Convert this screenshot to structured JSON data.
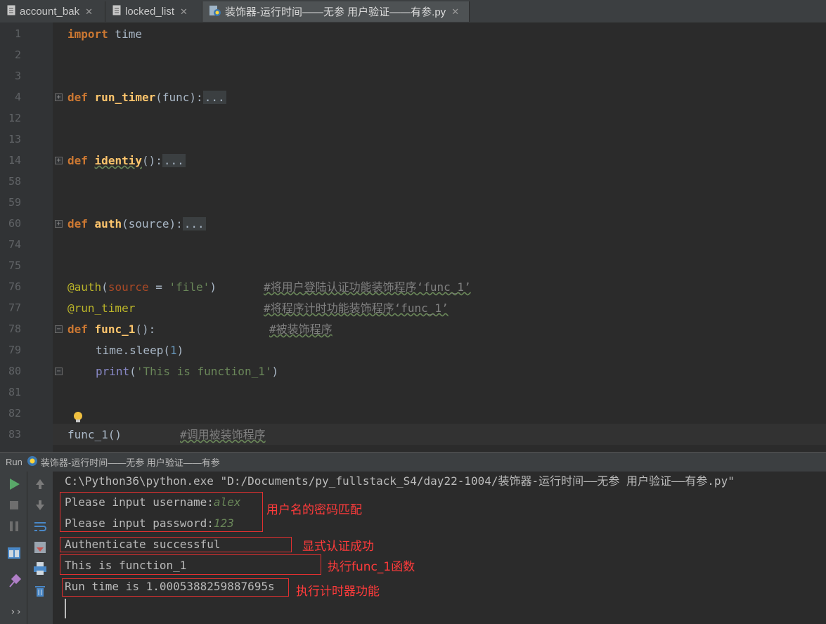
{
  "tabs": [
    {
      "label": "account_bak"
    },
    {
      "label": "locked_list"
    },
    {
      "label": "装饰器-运行时间——无参 用户验证——有参.py"
    }
  ],
  "editor": {
    "line_numbers": [
      "1",
      "2",
      "3",
      "4",
      "12",
      "13",
      "14",
      "58",
      "59",
      "60",
      "74",
      "75",
      "76",
      "77",
      "78",
      "79",
      "80",
      "81",
      "82",
      "83"
    ],
    "line1": {
      "kw": "import",
      "rest": " time"
    },
    "line4": {
      "kw": "def",
      "name": "run_timer",
      "args": "(func):",
      "fold": "..."
    },
    "line14": {
      "kw": "def",
      "name": "identiy",
      "args": "():",
      "fold": "..."
    },
    "line60": {
      "kw": "def",
      "name": "auth",
      "args": "(source):",
      "fold": "..."
    },
    "line76": {
      "dec": "@auth",
      "open": "(",
      "param": "source",
      "eq": " = ",
      "str": "'file'",
      "close": ")",
      "comment": "#将用户登陆认证功能装饰程序‘func_1’"
    },
    "line77": {
      "dec": "@run_timer",
      "comment": "#将程序计时功能装饰程序‘func_1’"
    },
    "line78": {
      "kw": "def",
      "name": "func_1",
      "args": "():",
      "comment": "#被装饰程序"
    },
    "line79": {
      "obj": "time.sleep(",
      "num": "1",
      "close": ")"
    },
    "line80": {
      "bi": "print",
      "open": "(",
      "str": "'This is function_1'",
      "close": ")"
    },
    "line83": {
      "call": "func_1()",
      "comment": "#调用被装饰程序"
    }
  },
  "run": {
    "tab_label": "Run",
    "config_name": "装饰器-运行时间——无参 用户验证——有参",
    "command": "C:\\Python36\\python.exe \"D:/Documents/py_fullstack_S4/day22-1004/装饰器-运行时间——无参 用户验证——有参.py\"",
    "username_prompt": "Please input username:",
    "username_value": "alex",
    "password_prompt": "Please input password:",
    "password_value": "123",
    "auth_msg": "Authenticate successful",
    "func_msg": "This is function_1",
    "time_msg": "Run time is 1.0005388259887695s"
  },
  "annotations": {
    "a1": "用户名的密码匹配",
    "a2": "显式认证成功",
    "a3": "执行func_1函数",
    "a4": "执行计时器功能"
  },
  "colors": {
    "keyword": "#cc7832",
    "function": "#ffc66d",
    "string": "#6a8759",
    "comment": "#808080",
    "annotation_red": "#ff3b3b"
  }
}
